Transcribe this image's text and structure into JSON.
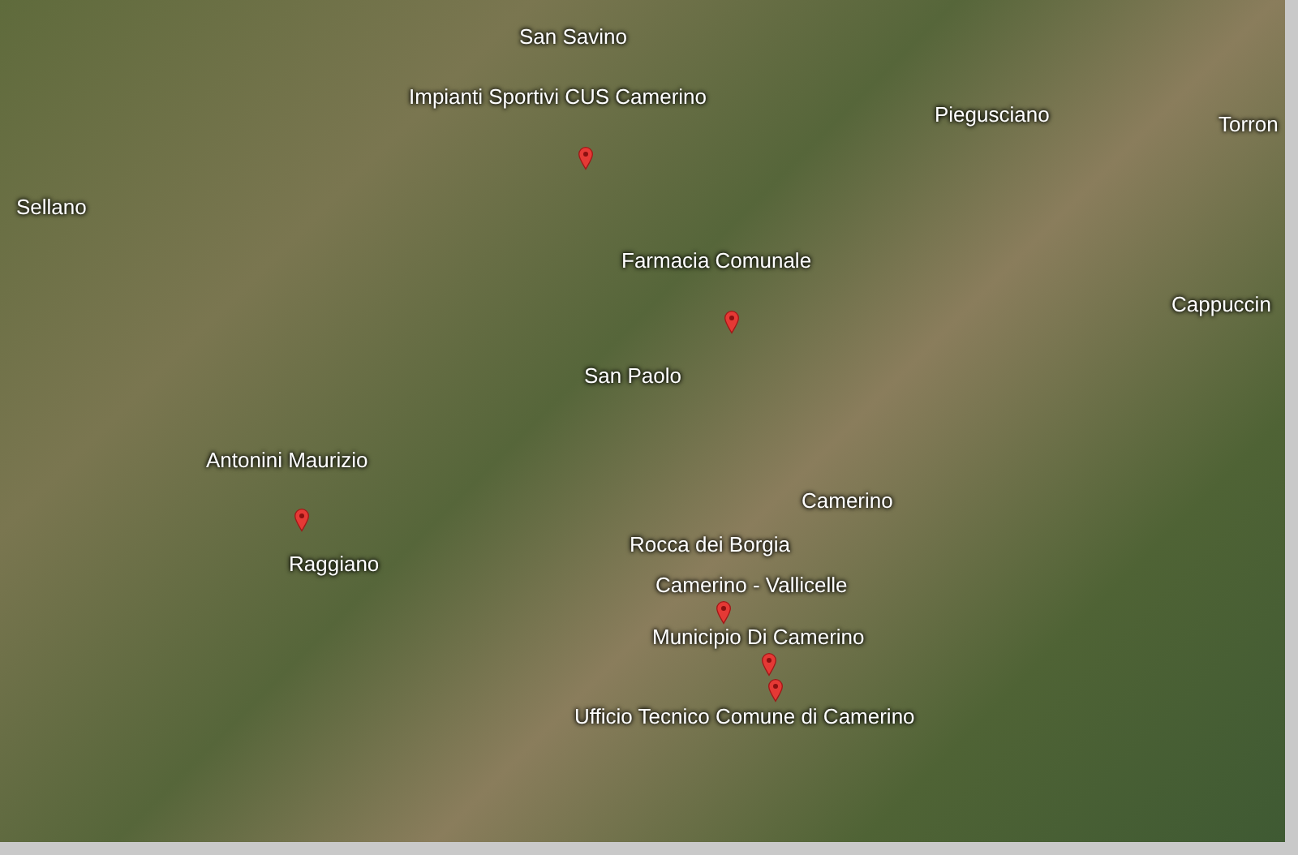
{
  "map": {
    "labels": [
      {
        "text": "San Savino"
      },
      {
        "text": "Impianti Sportivi CUS Camerino"
      },
      {
        "text": "Piegusciano"
      },
      {
        "text": "Torron"
      },
      {
        "text": "Sellano"
      },
      {
        "text": "Farmacia Comunale"
      },
      {
        "text": "Cappuccin"
      },
      {
        "text": "San Paolo"
      },
      {
        "text": "Antonini Maurizio"
      },
      {
        "text": "Camerino"
      },
      {
        "text": "Raggiano"
      },
      {
        "text": "Rocca dei Borgia"
      },
      {
        "text": "Camerino - Vallicelle"
      },
      {
        "text": "Municipio Di Camerino"
      },
      {
        "text": "Ufficio Tecnico Comune di Camerino"
      }
    ]
  }
}
